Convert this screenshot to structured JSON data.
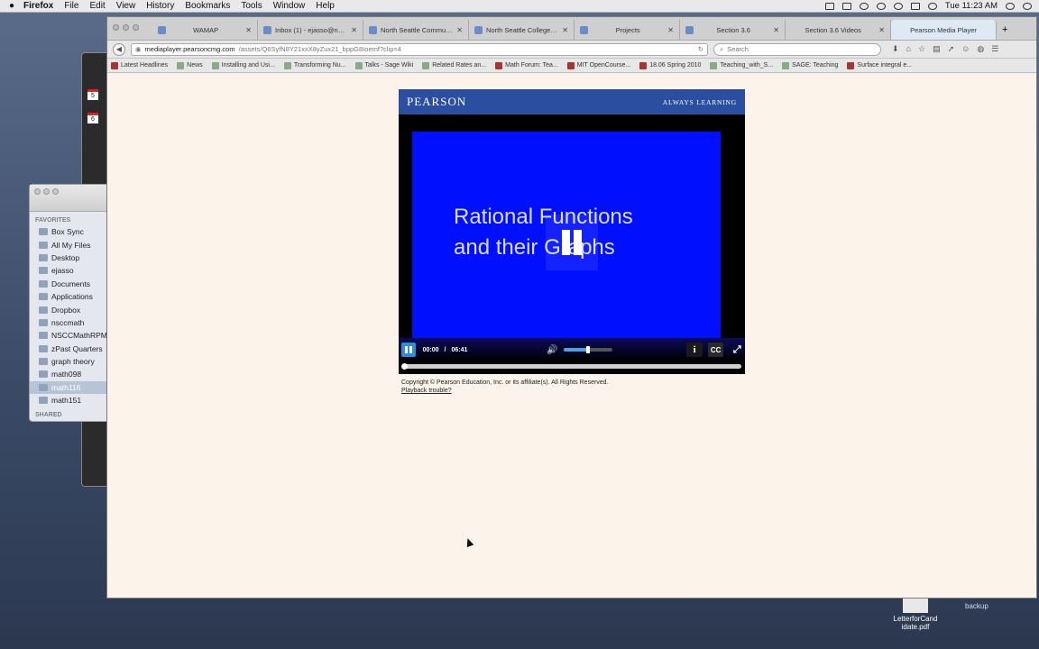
{
  "menubar": {
    "app": "Firefox",
    "items": [
      "File",
      "Edit",
      "View",
      "History",
      "Bookmarks",
      "Tools",
      "Window",
      "Help"
    ],
    "clock": "Tue 11:23 AM"
  },
  "finder": {
    "section_favorites": "FAVORITES",
    "items": [
      "Box Sync",
      "All My Files",
      "Desktop",
      "ejasso",
      "Documents",
      "Applications",
      "Dropbox",
      "nsccmath",
      "NSCCMathRPM",
      "zPast Quarters",
      "graph theory",
      "math098",
      "math116",
      "math151"
    ],
    "section_shared": "SHARED",
    "calendar_days": [
      "5",
      "6"
    ]
  },
  "browser": {
    "tabs": [
      {
        "label": "WAMAP"
      },
      {
        "label": "Inbox (1) - ejasso@nor..."
      },
      {
        "label": "North Seattle Communi..."
      },
      {
        "label": "North Seattle College | ..."
      },
      {
        "label": "Projects"
      },
      {
        "label": "Section 3.6"
      },
      {
        "label": "Section 3.6 Videos"
      },
      {
        "label": "Pearson Media Player"
      }
    ],
    "url_domain": "mediaplayer.pearsoncmg.com",
    "url_path": "/assets/Q6SyfN8Y21xxX8yZux21_bppG8Ioemf?clip=4",
    "search_placeholder": "Search",
    "bookmarks": [
      "Latest Headlines",
      "News",
      "Installing and Usi...",
      "Transforming Nu...",
      "Talks - Sage Wiki",
      "Related Rates an...",
      "Math Forum: Tea...",
      "MIT OpenCourse...",
      "18.06 Spring 2010",
      "Teaching_with_S...",
      "SAGE: Teaching",
      "Surface integral e..."
    ]
  },
  "player": {
    "logo": "PEARSON",
    "tagline": "ALWAYS LEARNING",
    "video_title_line1": "Rational Functions",
    "video_title_line2": "and their Graphs",
    "current_time": "00:00",
    "separator": "/",
    "duration": "06:41",
    "volume_level": 0.5,
    "progress": 0.0,
    "info_label": "i",
    "cc_label": "CC"
  },
  "footer": {
    "copyright": "Copyright © Pearson Education, Inc. or its affiliate(s). All Rights Reserved.",
    "trouble_link": "Playback trouble?"
  },
  "desktop": {
    "file_name": "LetterforCand idate.pdf",
    "folder_name": "backup"
  },
  "colors": {
    "pearson_blue": "#2b4ea0",
    "video_bg": "#0010ff",
    "page_bg": "#fcf4ea"
  }
}
